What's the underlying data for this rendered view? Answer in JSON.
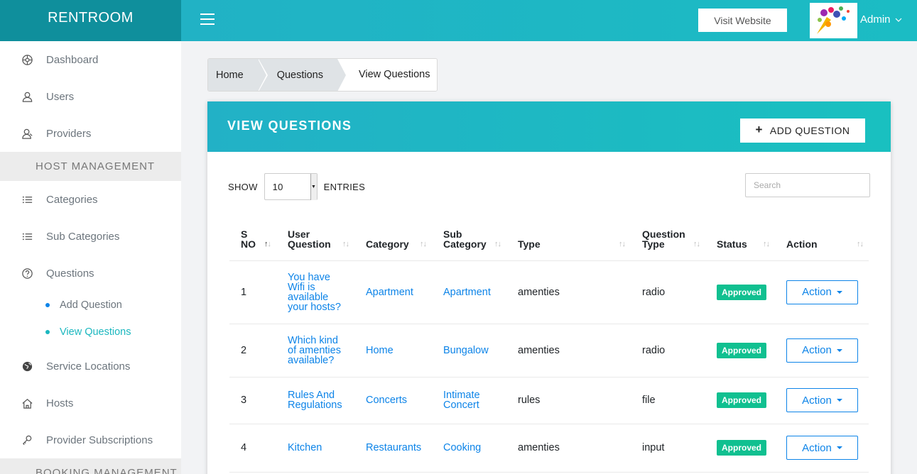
{
  "brand": "RENTROOM",
  "sidebar": {
    "top_items": [
      {
        "label": "Dashboard",
        "icon": "dashboard-icon"
      },
      {
        "label": "Users",
        "icon": "user-icon"
      },
      {
        "label": "Providers",
        "icon": "providers-icon"
      }
    ],
    "section_host": "HOST MANAGEMENT",
    "host_items": [
      {
        "label": "Categories",
        "icon": "list-icon"
      },
      {
        "label": "Sub Categories",
        "icon": "list-icon"
      },
      {
        "label": "Questions",
        "icon": "question-icon"
      }
    ],
    "sub_items": [
      {
        "label": "Add Question",
        "active": false
      },
      {
        "label": "View Questions",
        "active": true
      }
    ],
    "more_items": [
      {
        "label": "Service Locations",
        "icon": "globe-icon"
      },
      {
        "label": "Hosts",
        "icon": "home-icon"
      },
      {
        "label": "Provider Subscriptions",
        "icon": "key-icon"
      }
    ],
    "section_booking": "BOOKING MANAGEMENT"
  },
  "topbar": {
    "visit_label": "Visit Website",
    "admin_label": "Admin"
  },
  "breadcrumb": [
    "Home",
    "Questions",
    "View Questions"
  ],
  "card": {
    "title": "VIEW QUESTIONS",
    "add_label": "ADD QUESTION",
    "show_label": "SHOW",
    "entries_value": "10",
    "entries_label": "ENTRIES",
    "search_placeholder": "Search"
  },
  "table": {
    "headers": [
      {
        "lines": [
          "S",
          "NO"
        ],
        "sorted": true
      },
      {
        "lines": [
          "User",
          "Question"
        ],
        "sorted": false
      },
      {
        "lines": [
          "Category"
        ],
        "sorted": false
      },
      {
        "lines": [
          "Sub",
          "Category"
        ],
        "sorted": false
      },
      {
        "lines": [
          "Type"
        ],
        "sorted": false
      },
      {
        "lines": [
          "Question",
          "Type"
        ],
        "sorted": false
      },
      {
        "lines": [
          "Status"
        ],
        "sorted": false
      },
      {
        "lines": [
          "Action"
        ],
        "sorted": false
      }
    ],
    "rows": [
      {
        "sno": "1",
        "question": [
          "You have",
          "Wifi is",
          "available",
          "your hosts?"
        ],
        "category": "Apartment",
        "sub": [
          "Apartment"
        ],
        "type": "amenties",
        "qtype": "radio",
        "status": "Approved",
        "action": "Action"
      },
      {
        "sno": "2",
        "question": [
          "Which kind",
          "of amenties",
          "available?"
        ],
        "category": "Home",
        "sub": [
          "Bungalow"
        ],
        "type": "amenties",
        "qtype": "radio",
        "status": "Approved",
        "action": "Action"
      },
      {
        "sno": "3",
        "question": [
          "Rules And",
          "Regulations"
        ],
        "category": "Concerts",
        "sub": [
          "Intimate",
          "Concert"
        ],
        "type": "rules",
        "qtype": "file",
        "status": "Approved",
        "action": "Action"
      },
      {
        "sno": "4",
        "question": [
          "Kitchen"
        ],
        "category": "Restaurants",
        "sub": [
          "Cooking"
        ],
        "type": "amenties",
        "qtype": "input",
        "status": "Approved",
        "action": "Action"
      }
    ]
  },
  "colors": {
    "brand_bg": "#0f8f9c",
    "topbar": "#1fb6c5",
    "link": "#0d84e8",
    "approved": "#10c090",
    "active_sub": "#1bb7bf"
  }
}
